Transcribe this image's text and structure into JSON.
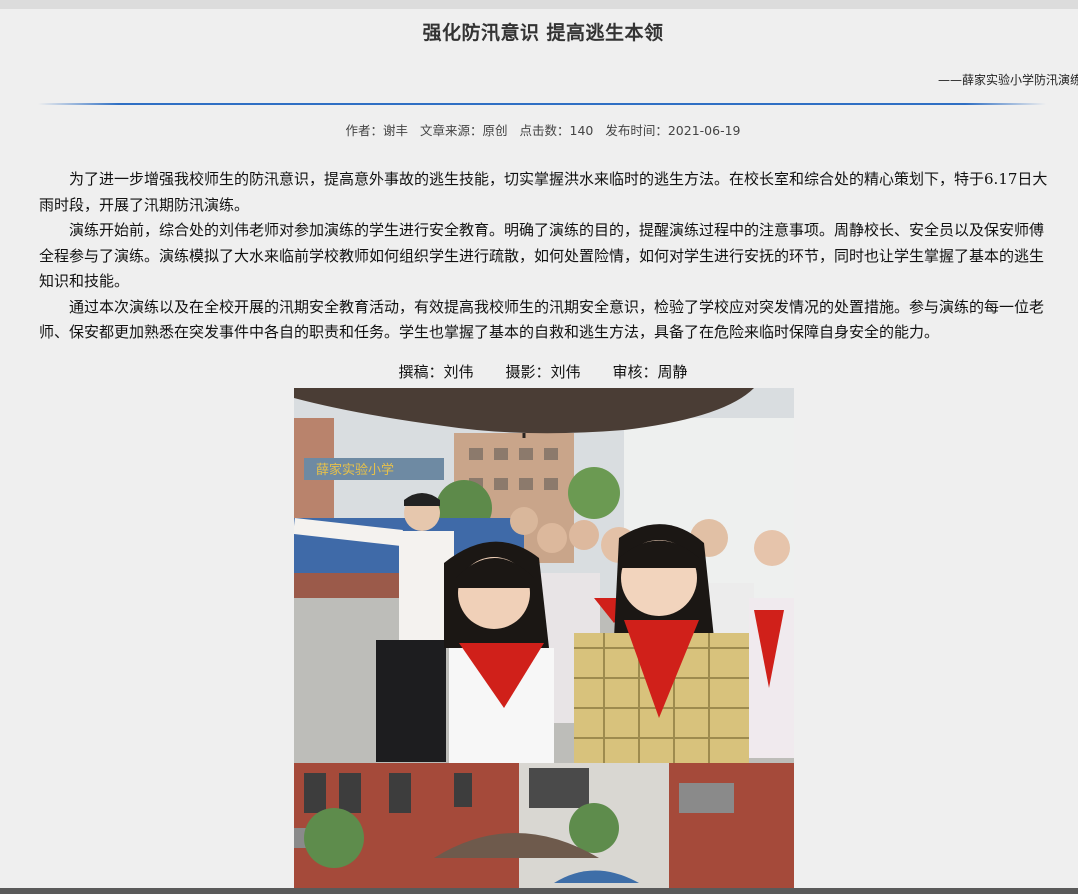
{
  "article": {
    "title": "强化防汛意识 提高逃生本领",
    "subtitle": "——薛家实验小学防汛演练",
    "meta": {
      "author": "作者：谢丰",
      "source": "文章来源：原创",
      "clicks": "点击数：140",
      "date": "发布时间：2021-06-19"
    },
    "paragraphs": [
      "为了进一步增强我校师生的防汛意识，提高意外事故的逃生技能，切实掌握洪水来临时的逃生方法。在校长室和综合处的精心策划下，特于6.17日大雨时段，开展了汛期防汛演练。",
      "演练开始前，综合处的刘伟老师对参加演练的学生进行安全教育。明确了演练的目的，提醒演练过程中的注意事项。周静校长、安全员以及保安师傅全程参与了演练。演练模拟了大水来临前学校教师如何组织学生进行疏散，如何处置险情，如何对学生进行安抚的环节，同时也让学生掌握了基本的逃生知识和技能。",
      "通过本次演练以及在全校开展的汛期安全教育活动，有效提高我校师生的汛期安全意识，检验了学校应对突发情况的处置措施。参与演练的每一位老师、保安都更加熟悉在突发事件中各自的职责和任务。学生也掌握了基本的自救和逃生方法，具备了在危险来临时保障自身安全的能力。"
    ],
    "credits": {
      "writer": "撰稿：刘伟",
      "photographer": "摄影：刘伟",
      "reviewer": "审核：周静"
    },
    "photo_sign": "薛家实验小学"
  },
  "colors": {
    "divider": "#2f6fc4",
    "background": "#efefef",
    "scarf_red": "#d0201a"
  }
}
